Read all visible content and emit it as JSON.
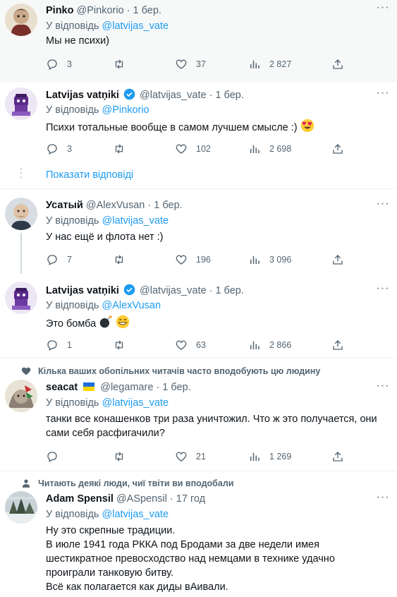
{
  "tweets": [
    {
      "name": "Pinko",
      "handle": "@Pinkorio",
      "time": "1 бер.",
      "reply_prefix": "У відповідь",
      "reply_to": "@latvijas_vate",
      "text": "Мы не психи)",
      "replies": "3",
      "retweets": "",
      "likes": "37",
      "views": "2 827"
    },
    {
      "name": "Latvijas vatņiki",
      "handle": "@latvijas_vate",
      "time": "1 бер.",
      "reply_prefix": "У відповідь",
      "reply_to": "@Pinkorio",
      "text": "Психи тотальные вообще в самом лучшем смысле :)",
      "replies": "3",
      "retweets": "",
      "likes": "102",
      "views": "2 698"
    },
    {
      "name": "Усатый",
      "handle": "@AlexVusan",
      "time": "1 бер.",
      "reply_prefix": "У відповідь",
      "reply_to": "@latvijas_vate",
      "text": "У нас ещё и флота нет :)",
      "replies": "7",
      "retweets": "",
      "likes": "196",
      "views": "3 096"
    },
    {
      "name": "Latvijas vatņiki",
      "handle": "@latvijas_vate",
      "time": "1 бер.",
      "reply_prefix": "У відповідь",
      "reply_to": "@AlexVusan",
      "text": "Это бомба",
      "replies": "1",
      "retweets": "",
      "likes": "63",
      "views": "2 866"
    },
    {
      "context": "Кілька ваших обопільних читачів часто вподобують цю людину",
      "name": "seacat",
      "handle": "@legamare",
      "time": "1 бер.",
      "reply_prefix": "У відповідь",
      "reply_to": "@latvijas_vate",
      "text_lines": [
        "танки все конашенков три раза уничтожил. Что ж это получается, они",
        "сами себя расфигачили?"
      ],
      "replies": "",
      "retweets": "",
      "likes": "21",
      "views": "1 269"
    },
    {
      "context": "Читають деякі люди, чиї твіти ви вподобали",
      "name": "Adam Spensil",
      "handle": "@ASpensil",
      "time": "17 год",
      "reply_prefix": "У відповідь",
      "reply_to": "@latvijas_vate",
      "text_lines": [
        "Ну это скрепные традиции.",
        "В июле  1941 года РККА  под Бродами за две недели имея",
        "шестикратное  превосходство над немцами в технике удачно",
        "проиграли танковую битву.",
        "Всё как полагается как диды вАивали."
      ]
    }
  ],
  "show_replies": "Показати відповіді",
  "colors": {
    "accent": "#1d9bf0",
    "secondary_text": "#536471",
    "divider": "#eff3f4",
    "highlight_bg": "#f7f9f9"
  },
  "icons": [
    "reply-icon",
    "retweet-icon",
    "like-icon",
    "views-icon",
    "share-icon",
    "more-icon",
    "verified-badge-icon",
    "heart-context-icon",
    "person-context-icon",
    "heart-eyes-emoji",
    "bomb-emoji",
    "grin-emoji",
    "ukraine-flag-icon"
  ]
}
